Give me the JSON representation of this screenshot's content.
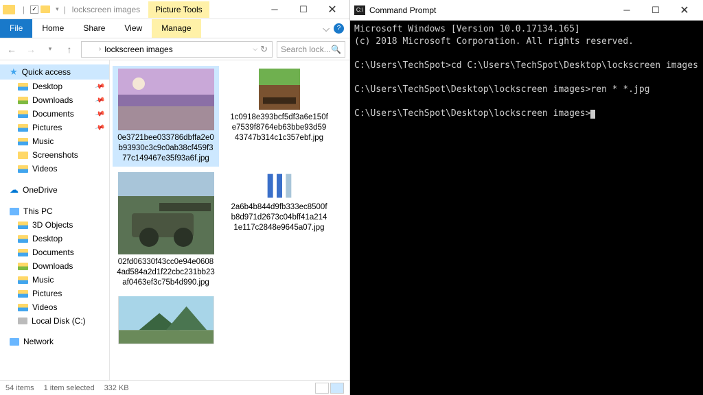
{
  "explorer": {
    "title_path": "lockscreen images",
    "picture_tools": "Picture Tools",
    "ribbon": {
      "file": "File",
      "home": "Home",
      "share": "Share",
      "view": "View",
      "manage": "Manage"
    },
    "addr_crumb": "lockscreen images",
    "search_placeholder": "Search lock...",
    "nav": {
      "quick": "Quick access",
      "quick_items": [
        "Desktop",
        "Downloads",
        "Documents",
        "Pictures",
        "Music",
        "Screenshots",
        "Videos"
      ],
      "onedrive": "OneDrive",
      "thispc": "This PC",
      "pc_items": [
        "3D Objects",
        "Desktop",
        "Documents",
        "Downloads",
        "Music",
        "Pictures",
        "Videos",
        "Local Disk (C:)"
      ],
      "network": "Network"
    },
    "items": [
      {
        "name": "0e3721bee033786dbffa2e0b93930c3c9c0ab38cf459f377c149467e35f93a6f.jpg"
      },
      {
        "name": "1c0918e393bcf5df3a6e150fe7539f8764eb63bbe93d5943747b314c1c357ebf.jpg"
      },
      {
        "name": "02fd06330f43cc0e94e06084ad584a2d1f22cbc231bb23af0463ef3c75b4d990.jpg"
      },
      {
        "name": "2a6b4b844d9fb333ec8500fb8d971d2673c04bff41a2141e117c2848e9645a07.jpg"
      },
      {
        "name": ""
      }
    ],
    "status": {
      "count": "54 items",
      "selected": "1 item selected",
      "size": "332 KB"
    }
  },
  "cmd": {
    "title": "Command Prompt",
    "line1": "Microsoft Windows [Version 10.0.17134.165]",
    "line2": "(c) 2018 Microsoft Corporation. All rights reserved.",
    "prompt1": "C:\\Users\\TechSpot>",
    "cmd1": "cd C:\\Users\\TechSpot\\Desktop\\lockscreen images",
    "prompt2": "C:\\Users\\TechSpot\\Desktop\\lockscreen images>",
    "cmd2": "ren * *.jpg",
    "prompt3": "C:\\Users\\TechSpot\\Desktop\\lockscreen images>"
  }
}
